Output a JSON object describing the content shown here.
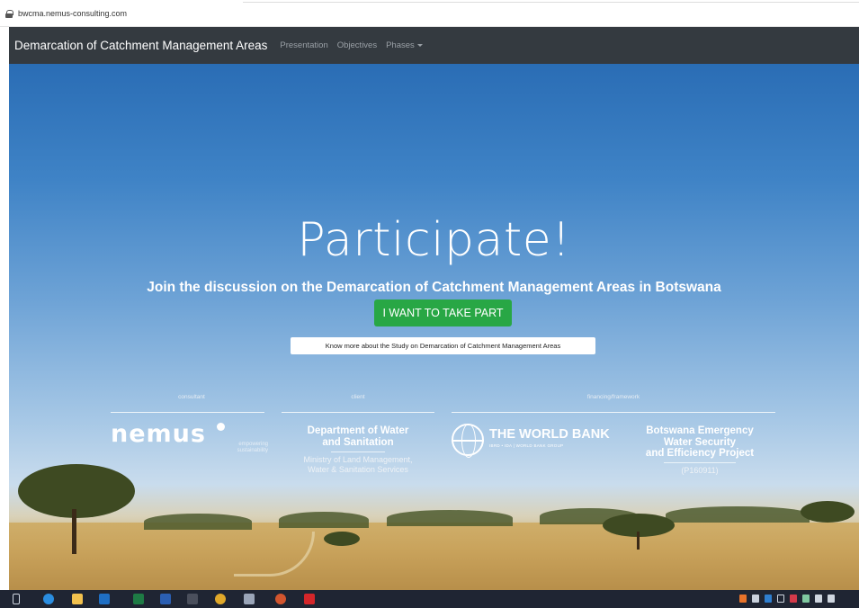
{
  "browser": {
    "url": "bwcma.nemus-consulting.com"
  },
  "navbar": {
    "brand": "Demarcation of Catchment Management Areas",
    "links": [
      "Presentation",
      "Objectives",
      "Phases"
    ]
  },
  "hero": {
    "title": "Participate!",
    "subtitle": "Join the discussion on the Demarcation of Catchment Management Areas in Botswana",
    "cta_label": "I WANT TO TAKE PART",
    "more_label": "Know more about the Study on Demarcation of Catchment Management Areas"
  },
  "partners": {
    "consultant_label": "consultant",
    "client_label": "client",
    "financing_label": "financing/framework",
    "nemus_name": "nemus",
    "nemus_tagline_1": "empowering",
    "nemus_tagline_2": "sustainability",
    "dws_line_1": "Department of Water",
    "dws_line_2": "and Sanitation",
    "ministry_line_1": "Ministry of Land Management,",
    "ministry_line_2": "Water & Sanitation Services",
    "worldbank_name": "THE WORLD BANK",
    "worldbank_sub": "IBRD • IDA | WORLD BANK GROUP",
    "project_line_1": "Botswana Emergency",
    "project_line_2": "Water Security",
    "project_line_3": "and Efficiency Project",
    "project_code": "(P160911)"
  },
  "taskbar": {
    "icons": [
      "task-view-icon",
      "edge-icon",
      "file-explorer-icon",
      "outlook-icon",
      "excel-icon",
      "word-icon",
      "calculator-icon",
      "chrome-icon",
      "app-icon",
      "powerpoint-icon",
      "acrobat-icon"
    ]
  },
  "colors": {
    "navbar": "#343a40",
    "cta": "#28a745",
    "taskbar": "#1f2533"
  }
}
